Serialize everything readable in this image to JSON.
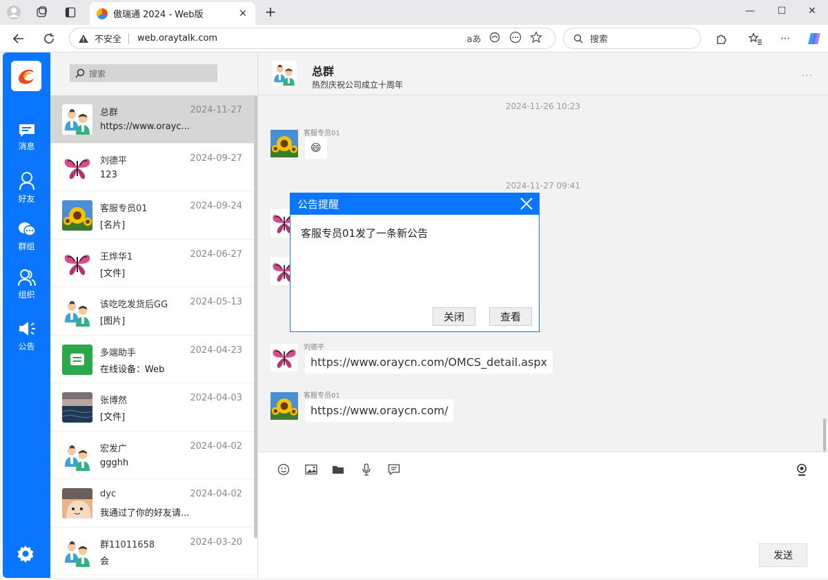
{
  "browser": {
    "tab_title": "傲瑞通 2024 - Web版",
    "insecure_label": "不安全",
    "url": "web.oraytalk.com",
    "search_placeholder": "搜索"
  },
  "rail": {
    "items": [
      {
        "label": "消息",
        "icon": "message-icon"
      },
      {
        "label": "好友",
        "icon": "person-icon"
      },
      {
        "label": "群组",
        "icon": "group-chat-icon"
      },
      {
        "label": "组织",
        "icon": "organization-icon"
      },
      {
        "label": "公告",
        "icon": "megaphone-icon"
      }
    ]
  },
  "contacts": {
    "search_placeholder": "搜索",
    "items": [
      {
        "name": "总群",
        "date": "2024-11-27",
        "message": "https://www.orayc...",
        "avatar": "group"
      },
      {
        "name": "刘德平",
        "date": "2024-09-27",
        "message": "123",
        "avatar": "butterfly"
      },
      {
        "name": "客服专员01",
        "date": "2024-09-24",
        "message": "[名片]",
        "avatar": "sunflower"
      },
      {
        "name": "王烨华1",
        "date": "2024-06-27",
        "message": "[文件]",
        "avatar": "butterfly"
      },
      {
        "name": "该吃吃发货后GG",
        "date": "2024-05-13",
        "message": "[图片]",
        "avatar": "group"
      },
      {
        "name": "多端助手",
        "date": "2024-04-23",
        "message": "在线设备：Web",
        "avatar": "assistant"
      },
      {
        "name": "张博然",
        "date": "2024-04-03",
        "message": "[文件]",
        "avatar": "sea"
      },
      {
        "name": "宏发广",
        "date": "2024-04-02",
        "message": "ggghh",
        "avatar": "group"
      },
      {
        "name": "dyc",
        "date": "2024-04-02",
        "message": "我通过了你的好友请...",
        "avatar": "cartoon"
      },
      {
        "name": "群11011658",
        "date": "2024-03-20",
        "message": "会",
        "avatar": "group"
      }
    ]
  },
  "chat": {
    "title": "总群",
    "subtitle": "热烈庆祝公司成立十周年",
    "timestamps": [
      "2024-11-26 10:23",
      "2024-11-27 09:41"
    ],
    "messages": [
      {
        "sender": "客服专员01",
        "text": "😄",
        "avatar": "sunflower"
      },
      {
        "sender": "刘德平",
        "text": "https://www.oraycn.com/OMCS_detail.aspx",
        "avatar": "butterfly"
      },
      {
        "sender": "客服专员01",
        "text": "https://www.oraycn.com/",
        "avatar": "sunflower"
      }
    ],
    "send_label": "发送"
  },
  "dialog": {
    "title": "公告提醒",
    "body": "客服专员01发了一条新公告",
    "close_label": "关闭",
    "view_label": "查看"
  }
}
